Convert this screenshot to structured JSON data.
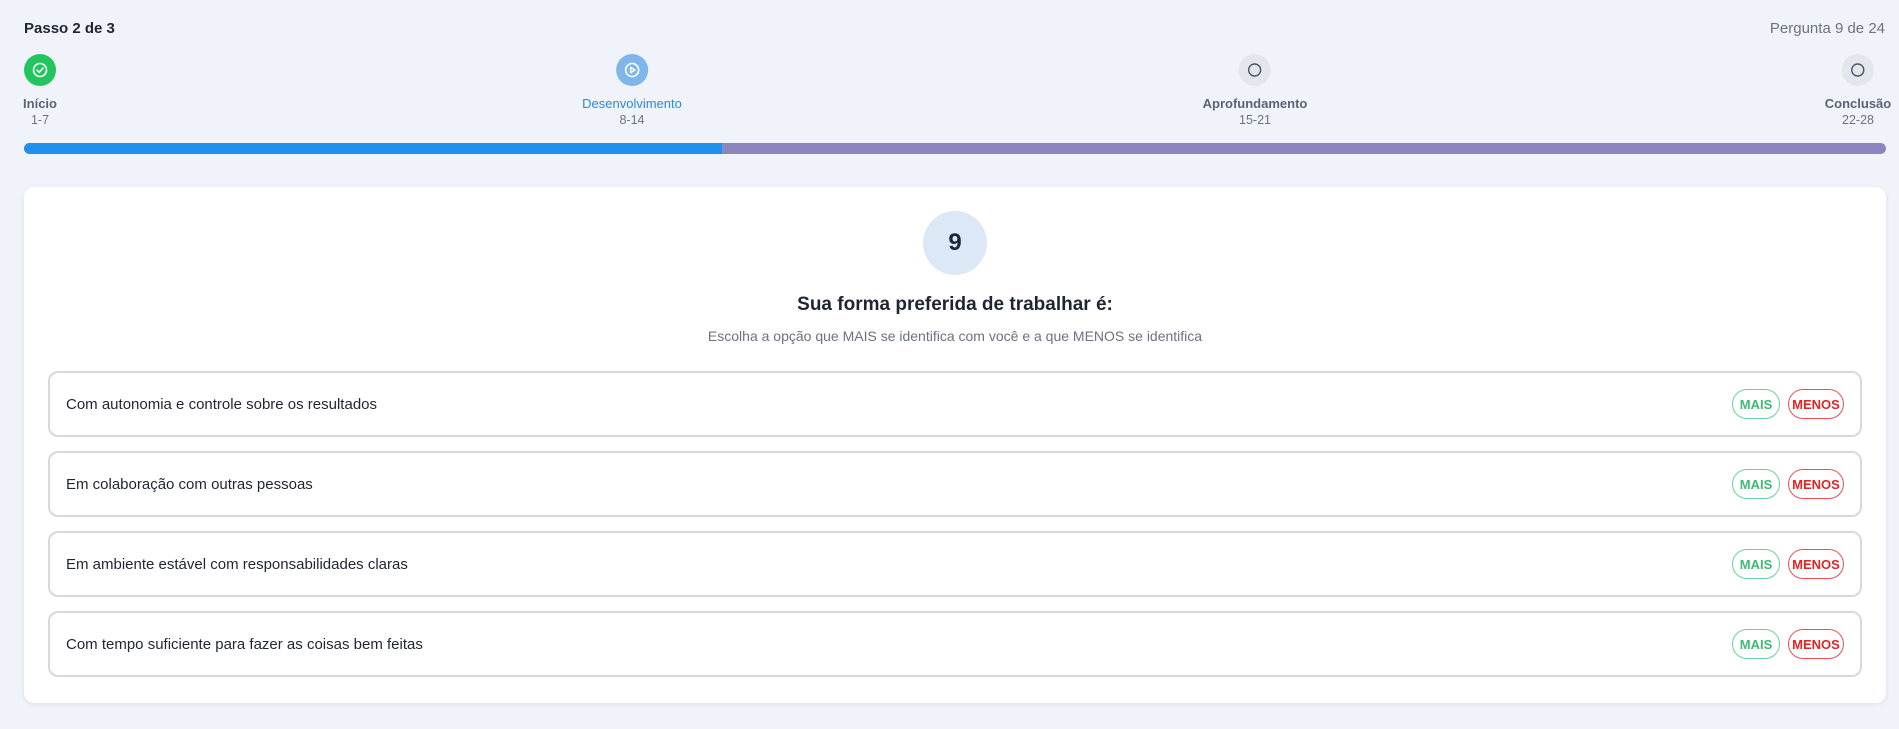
{
  "header": {
    "step_label": "Passo 2 de 3",
    "question_counter": "Pergunta 9 de 24"
  },
  "steps": [
    {
      "name": "Início",
      "range": "1-7",
      "status": "done",
      "icon": "check-circle-icon"
    },
    {
      "name": "Desenvolvimento",
      "range": "8-14",
      "status": "active",
      "icon": "play-circle-icon"
    },
    {
      "name": "Aprofundamento",
      "range": "15-21",
      "status": "pending",
      "icon": "circle-icon"
    },
    {
      "name": "Conclusão",
      "range": "22-28",
      "status": "pending",
      "icon": "circle-icon"
    }
  ],
  "progress": {
    "fraction": 0.375
  },
  "question": {
    "number": "9",
    "title": "Sua forma preferida de trabalhar é:",
    "subtitle": "Escolha a opção que MAIS se identifica com você e a que MENOS se identifica"
  },
  "options": [
    {
      "text": "Com autonomia e controle sobre os resultados",
      "more_label": "MAIS",
      "less_label": "MENOS"
    },
    {
      "text": "Em colaboração com outras pessoas",
      "more_label": "MAIS",
      "less_label": "MENOS"
    },
    {
      "text": "Em ambiente estável com responsabilidades claras",
      "more_label": "MAIS",
      "less_label": "MENOS"
    },
    {
      "text": "Com tempo suficiente para fazer as coisas bem feitas",
      "more_label": "MAIS",
      "less_label": "MENOS"
    }
  ],
  "colors": {
    "done": "#22c55e",
    "active": "#7fb6ea",
    "progress_fill": "#1e90ed",
    "progress_track": "#8c86be",
    "mais": "#3dbb72",
    "menos": "#e02424"
  }
}
